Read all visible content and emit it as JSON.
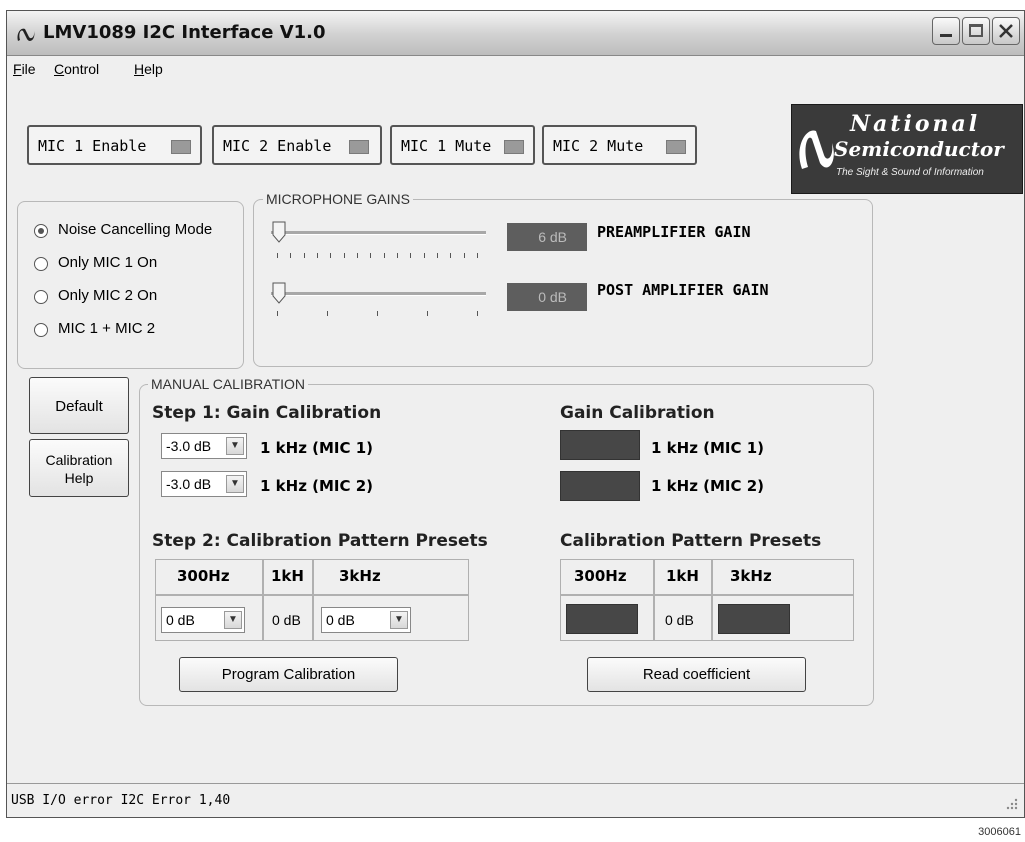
{
  "window": {
    "title": "LMV1089 I2C Interface V1.0"
  },
  "menu": [
    {
      "underline": "F",
      "rest": "ile"
    },
    {
      "underline": "C",
      "rest": "ontrol"
    },
    {
      "underline": "H",
      "rest": "elp"
    }
  ],
  "toggles": [
    "MIC 1 Enable",
    "MIC 2 Enable",
    "MIC 1 Mute",
    "MIC 2 Mute"
  ],
  "logo": {
    "line1": "National",
    "line2": "Semiconductor",
    "tagline": "The Sight & Sound of Information"
  },
  "modes": {
    "options": [
      "Noise Cancelling Mode",
      "Only MIC 1 On",
      "Only MIC 2 On",
      "MIC 1 + MIC 2"
    ],
    "selected_index": 0
  },
  "gains": {
    "title": "MICROPHONE GAINS",
    "preamp": {
      "value": "6 dB",
      "label": "PREAMPLIFIER GAIN",
      "slider_fraction": 0
    },
    "postamp": {
      "value": "0 dB",
      "label": "POST AMPLIFIER GAIN",
      "slider_fraction": 0
    }
  },
  "side_buttons": {
    "default": "Default",
    "calibration_help_1": "Calibration",
    "calibration_help_2": "Help"
  },
  "calibration": {
    "title": "MANUAL CALIBRATION",
    "step1": {
      "heading": "Step 1: Gain Calibration",
      "mic1": {
        "value": "-3.0 dB",
        "label": "1 kHz (MIC 1)"
      },
      "mic2": {
        "value": "-3.0 dB",
        "label": "1 kHz (MIC 2)"
      }
    },
    "readback": {
      "heading": "Gain Calibration",
      "mic1_label": "1 kHz (MIC 1)",
      "mic2_label": "1 kHz (MIC 2)"
    },
    "step2": {
      "heading": "Step 2: Calibration Pattern Presets",
      "columns": [
        "300Hz",
        "1kH",
        "3kHz"
      ],
      "values": [
        "0 dB",
        "0 dB",
        "0 dB"
      ]
    },
    "presets_read": {
      "heading": "Calibration Pattern Presets",
      "columns": [
        "300Hz",
        "1kH",
        "3kHz"
      ],
      "mid_value": "0 dB"
    },
    "program_button": "Program Calibration",
    "read_button": "Read coefficient"
  },
  "status": {
    "text": "USB I/O error  I2C Error  1,40"
  },
  "footnote": "3006061"
}
